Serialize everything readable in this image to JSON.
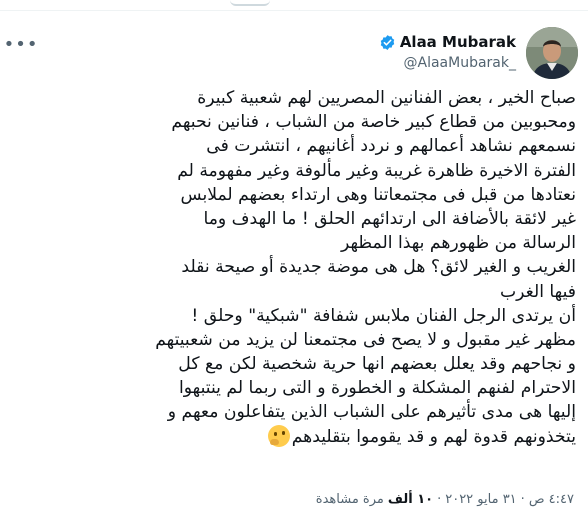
{
  "tweet": {
    "author": {
      "display_name": "Alaa Mubarak",
      "handle": "@AlaaMubarak_"
    },
    "lines": [
      "صباح الخير ، بعض الفنانين المصريين لهم شعبية كبيرة",
      "ومحبوبين من قطاع كبير خاصة من الشباب ، فنانين نحبهم",
      "نسمعهم نشاهد أعمالهم و نردد أغانيهم ، انتشرت فى",
      "الفترة الاخيرة ظاهرة غريبة وغير مألوفة وغير مفهومة لم",
      "نعتادها من قبل فى مجتمعاتنا وهى ارتداء بعضهم لملابس",
      "غير لائقة بالأضافة الى ارتدائهم الحلق ! ما الهدف وما",
      "الرسالة من ظهورهم بهذا المظهر",
      "الغريب و الغير لائق؟ هل هى موضة جديدة أو صيحة نقلد",
      "فيها الغرب",
      "أن يرتدى الرجل الفنان ملابس شفافة \"شبكية\" وحلق !",
      "مظهر غير مقبول و لا يصح فى مجتمعنا لن يزيد من شعبيتهم",
      "و نجاحهم وقد يعلل بعضهم انها حرية شخصية لكن مع كل",
      "الاحترام لفنهم المشكلة و الخطورة و التى ربما لم ينتبهوا",
      "إليها هى مدى تأثيرهم على الشباب الذين يتفاعلون معهم و",
      "يتخذونهم قدوة لهم و قد يقوموا بتقليدهم"
    ],
    "emoji_name": "thinking-face",
    "meta": {
      "time": "٤:٤٧ ص",
      "date": "٣١ مايو ٢٠٢٢",
      "separator": "·",
      "views_count": "١٠ ألف",
      "views_label": "مرة مشاهدة"
    }
  },
  "colors": {
    "text": "#0f1419",
    "secondary": "#536471",
    "verified_blue": "#1d9bf0"
  }
}
